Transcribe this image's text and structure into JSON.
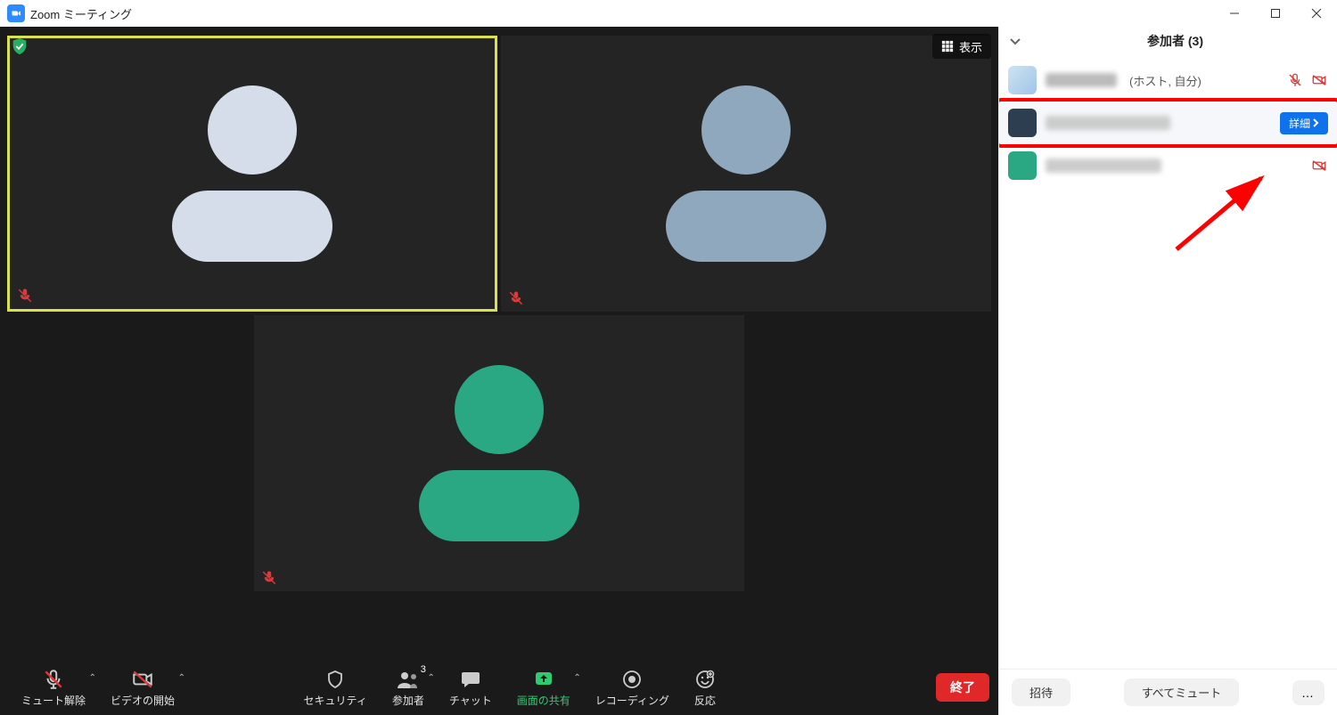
{
  "window": {
    "title": "Zoom ミーティング"
  },
  "topbar": {
    "view_label": "表示"
  },
  "tiles": [
    {
      "color": "#d4dde9",
      "active": true,
      "mic_off": true
    },
    {
      "color": "#8fa8bd",
      "active": false,
      "mic_off": true
    },
    {
      "color": "#2aa884",
      "active": false,
      "mic_off": true
    }
  ],
  "controls": {
    "mute": {
      "label": "ミュート解除"
    },
    "video": {
      "label": "ビデオの開始"
    },
    "security": {
      "label": "セキュリティ"
    },
    "participants": {
      "label": "参加者",
      "badge": "3"
    },
    "chat": {
      "label": "チャット"
    },
    "share": {
      "label": "画面の共有"
    },
    "record": {
      "label": "レコーディング"
    },
    "react": {
      "label": "反応"
    },
    "end": {
      "label": "終了"
    }
  },
  "panel": {
    "title": "参加者 (3)",
    "rows": [
      {
        "avatar_color": "#cfe3f0",
        "suffix": "(ホスト, 自分)",
        "mic_off": true,
        "cam_off": true,
        "highlighted": false,
        "detail": false
      },
      {
        "avatar_color": "#2c3e50",
        "suffix": "",
        "mic_off": false,
        "cam_off": false,
        "highlighted": true,
        "detail": true,
        "detail_label": "詳細"
      },
      {
        "avatar_color": "#2aa884",
        "suffix": "",
        "mic_off": false,
        "cam_off": true,
        "highlighted": false,
        "detail": false
      }
    ],
    "footer": {
      "invite": "招待",
      "mute_all": "すべてミュート"
    }
  },
  "colors": {
    "accent_blue": "#0e72ed",
    "danger_red": "#e02828",
    "highlight_red": "#ff0000",
    "muted_red": "#d93a3a",
    "share_green": "#2ecc71"
  }
}
